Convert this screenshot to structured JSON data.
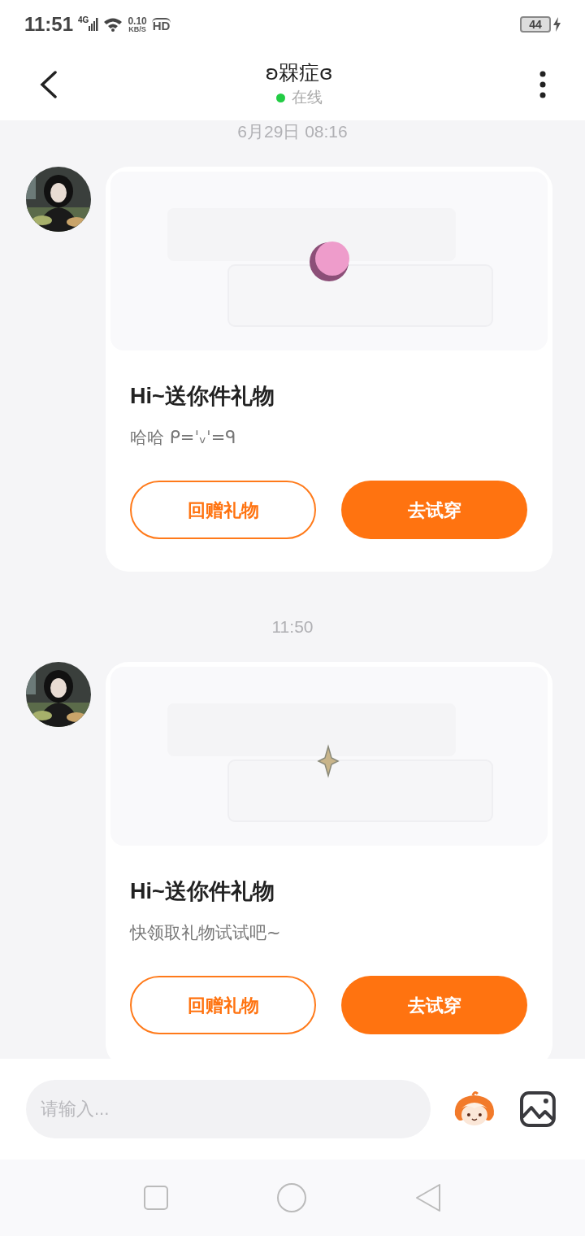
{
  "status_bar": {
    "time": "11:51",
    "network": "4G",
    "speed": "0.10",
    "speed_unit": "KB/S",
    "hd": "HD",
    "battery": "44",
    "charging": true
  },
  "header": {
    "title": "ʚ槑症ɞ",
    "status": "在线",
    "online": true
  },
  "messages": [
    {
      "timestamp": "6月29日 08:16",
      "picture": {
        "kind": "ball"
      },
      "title": "Hi~送你件礼物",
      "description": "哈哈 ᑭ=ˈᵥˈ=ᑫ",
      "buttons": [
        {
          "label": "回赠礼物",
          "kind": "outline"
        },
        {
          "label": "去试穿",
          "kind": "filled"
        }
      ]
    },
    {
      "timestamp": "11:50",
      "picture": {
        "kind": "sparkle"
      },
      "title": "Hi~送你件礼物",
      "description": "快领取礼物试试吧~",
      "buttons": [
        {
          "label": "回赠礼物",
          "kind": "outline"
        },
        {
          "label": "去试穿",
          "kind": "filled"
        }
      ]
    }
  ],
  "input": {
    "placeholder": "请输入..."
  }
}
